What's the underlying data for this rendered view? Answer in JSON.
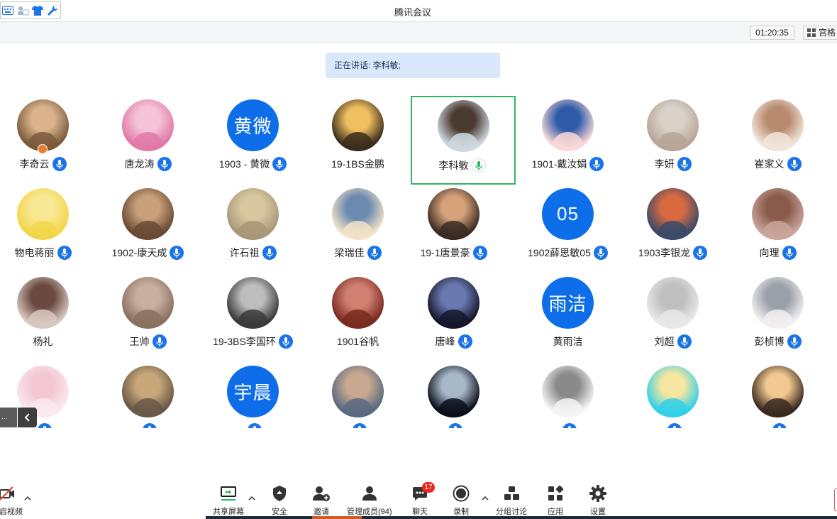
{
  "window": {
    "title": "腾讯会议"
  },
  "header": {
    "timer": "01:20:35",
    "view_label": "宫格"
  },
  "speaking": {
    "label": "正在讲话: 李科敏;"
  },
  "participants": [
    {
      "name": "李奇云",
      "mic": true,
      "avatar": "photo"
    },
    {
      "name": "唐龙涛",
      "mic": true,
      "avatar": "photo"
    },
    {
      "name": "1903 - 黄微",
      "mic": true,
      "avatar": "text",
      "avatar_text": "黄微"
    },
    {
      "name": "19-1BS金鹏",
      "mic": false,
      "avatar": "photo"
    },
    {
      "name": "李科敏",
      "mic": true,
      "speaking": true,
      "avatar": "photo"
    },
    {
      "name": "1901-戴汝娟",
      "mic": true,
      "avatar": "photo"
    },
    {
      "name": "李妍",
      "mic": true,
      "avatar": "photo"
    },
    {
      "name": "崔家义",
      "mic": true,
      "avatar": "photo"
    },
    {
      "name": "物电蒋丽",
      "mic": true,
      "avatar": "photo"
    },
    {
      "name": "1902-康天成",
      "mic": true,
      "avatar": "photo"
    },
    {
      "name": "许石祖",
      "mic": true,
      "avatar": "photo"
    },
    {
      "name": "梁瑞佳",
      "mic": true,
      "avatar": "photo"
    },
    {
      "name": "19-1唐景豪",
      "mic": true,
      "avatar": "photo"
    },
    {
      "name": "1902薛思敏05",
      "mic": true,
      "avatar": "text",
      "avatar_text": "05"
    },
    {
      "name": "1903李银龙",
      "mic": true,
      "avatar": "photo"
    },
    {
      "name": "向理",
      "mic": true,
      "avatar": "photo"
    },
    {
      "name": "杨礼",
      "mic": false,
      "avatar": "photo"
    },
    {
      "name": "王帅",
      "mic": true,
      "avatar": "photo"
    },
    {
      "name": "19-3BS李国环",
      "mic": true,
      "avatar": "photo"
    },
    {
      "name": "1901谷帆",
      "mic": false,
      "avatar": "photo"
    },
    {
      "name": "唐峰",
      "mic": true,
      "avatar": "photo"
    },
    {
      "name": "黄雨洁",
      "mic": false,
      "avatar": "text",
      "avatar_text": "雨洁"
    },
    {
      "name": "刘超",
      "mic": true,
      "avatar": "photo"
    },
    {
      "name": "彭桢博",
      "mic": true,
      "avatar": "photo"
    },
    {
      "name": "",
      "mic": true,
      "avatar": "photo"
    },
    {
      "name": "",
      "mic": true,
      "avatar": "photo"
    },
    {
      "name": "",
      "mic": true,
      "avatar": "text",
      "avatar_text": "宇晨"
    },
    {
      "name": "",
      "mic": true,
      "avatar": "photo"
    },
    {
      "name": "",
      "mic": true,
      "avatar": "photo"
    },
    {
      "name": "",
      "mic": true,
      "avatar": "photo"
    },
    {
      "name": "",
      "mic": true,
      "avatar": "photo"
    },
    {
      "name": "",
      "mic": true,
      "avatar": "photo"
    }
  ],
  "collapse": {
    "label": "..."
  },
  "toolbar": {
    "video": "开启视频",
    "share": "共享屏幕",
    "security": "安全",
    "invite": "邀请",
    "members": "管理成员(94)",
    "chat": "聊天",
    "chat_badge": "17",
    "record": "录制",
    "breakout": "分组讨论",
    "apps": "应用",
    "settings": "设置"
  },
  "colors": {
    "accent": "#1a73e8",
    "speaking_border": "#2fb561",
    "banner": "#d9e8fb",
    "badge": "#e9281c"
  }
}
